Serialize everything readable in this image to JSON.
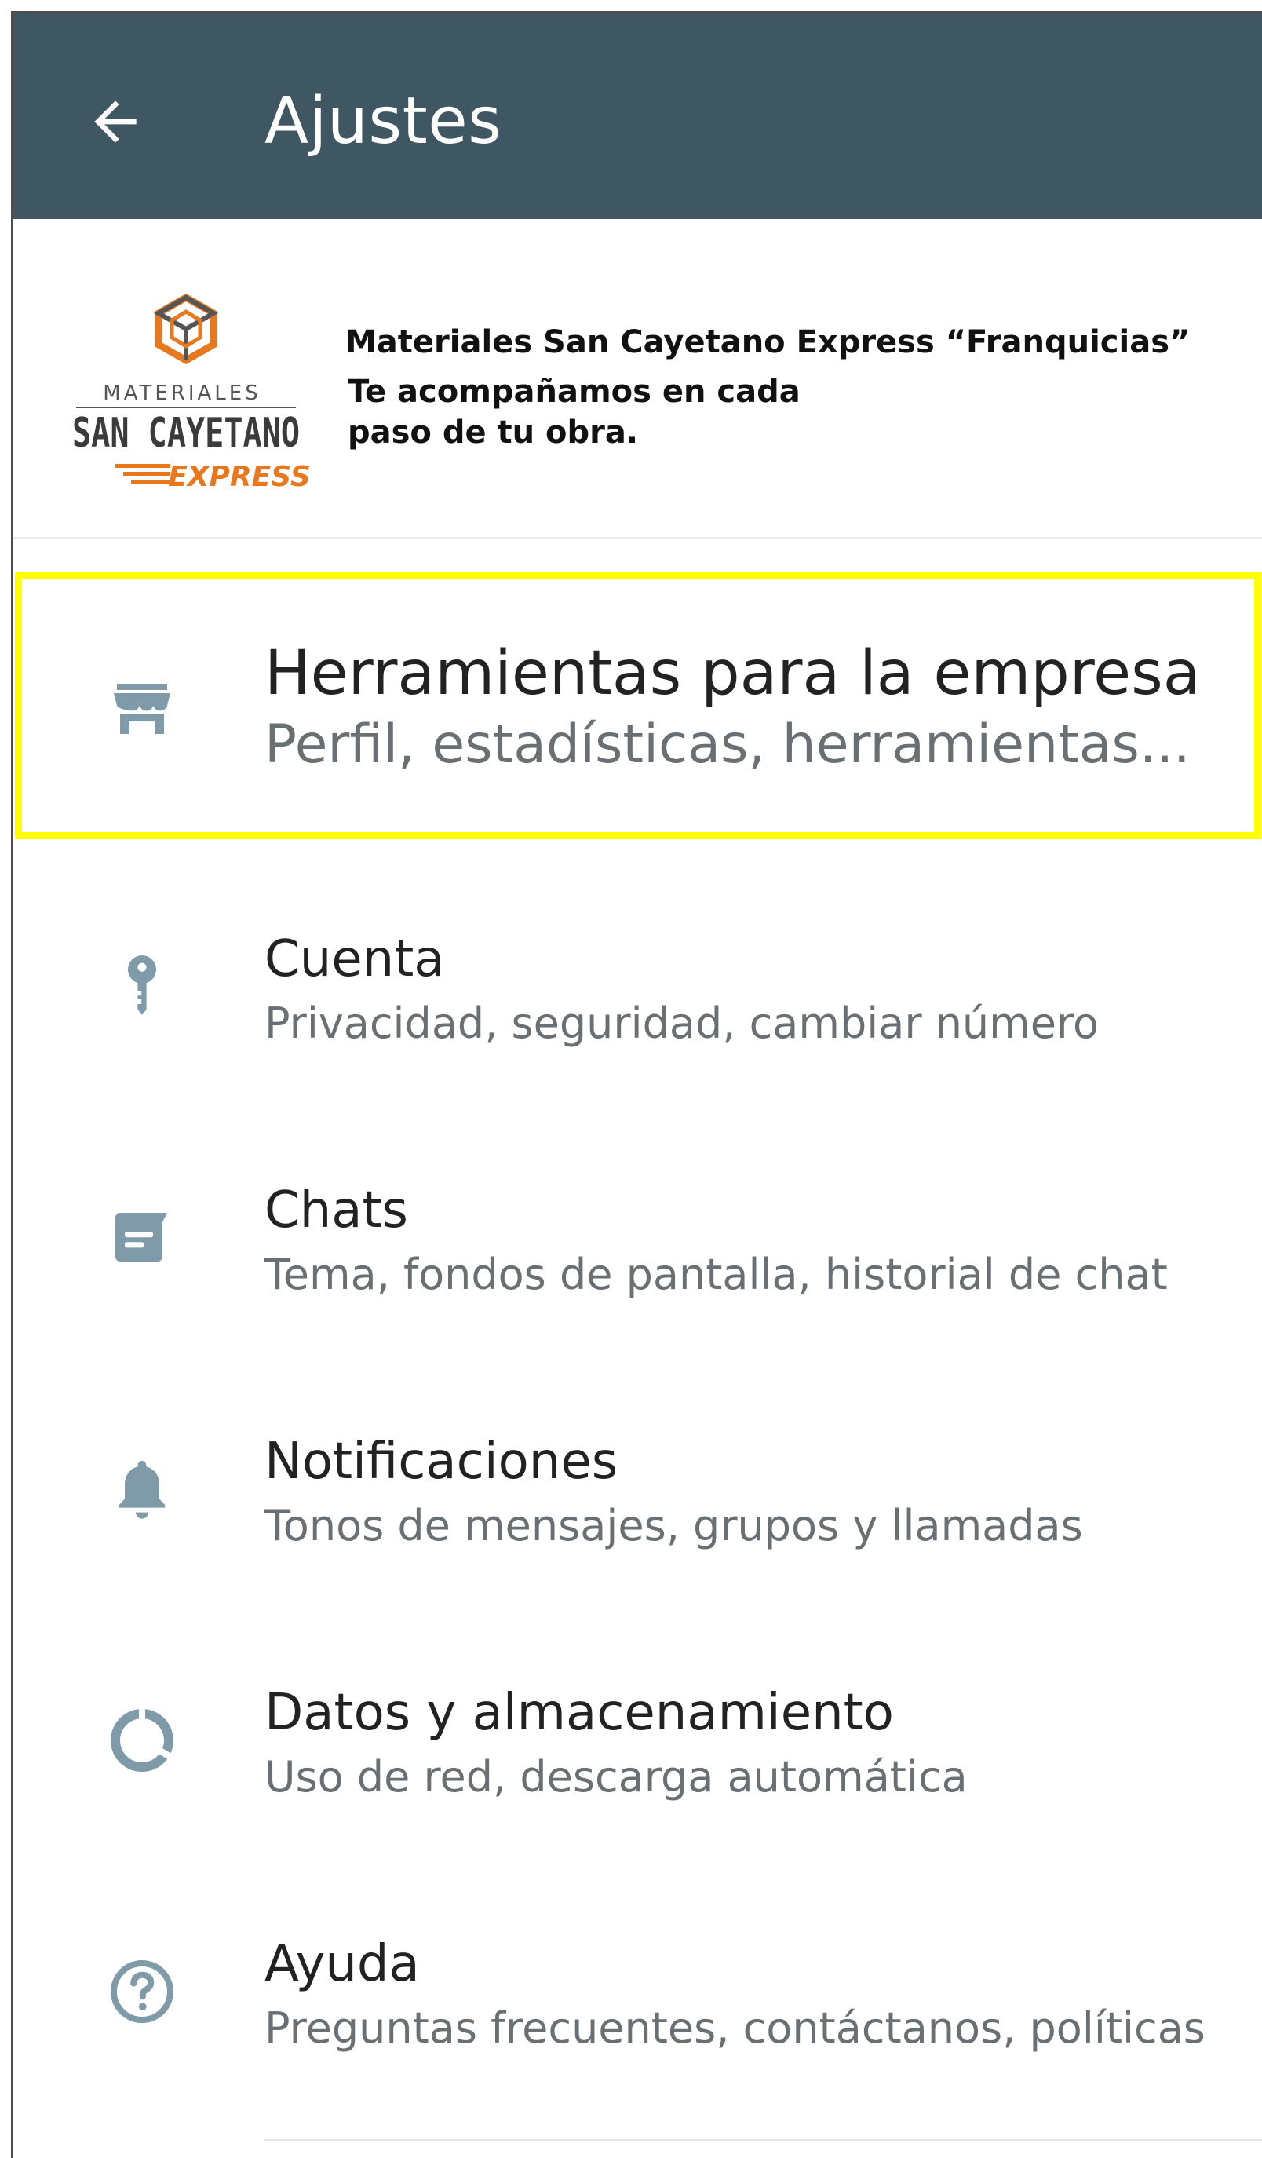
{
  "appbar": {
    "title": "Ajustes",
    "back_icon": "arrow-left-icon",
    "background": "#3f5663"
  },
  "profile": {
    "logo": {
      "top_text": "MATERIALES",
      "brand": "SAN CAYETANO",
      "sub": "EXPRESS",
      "accent": "#e8781e"
    },
    "name": "Materiales San Cayetano Express “Franquicias”",
    "tagline_line1": "Te acompañamos en cada",
    "tagline_line2": "paso de tu obra."
  },
  "highlight_color": "#ffff00",
  "icon_color": "#7f9aa8",
  "menu": [
    {
      "icon": "storefront-icon",
      "title": "Herramientas para la empresa",
      "subtitle": "Perfil, estadísticas, herramientas..."
    },
    {
      "icon": "key-icon",
      "title": "Cuenta",
      "subtitle": "Privacidad, seguridad, cambiar número"
    },
    {
      "icon": "chat-icon",
      "title": "Chats",
      "subtitle": "Tema, fondos de pantalla, historial de chat"
    },
    {
      "icon": "bell-icon",
      "title": "Notificaciones",
      "subtitle": "Tonos de mensajes, grupos y llamadas"
    },
    {
      "icon": "data-usage-icon",
      "title": "Datos y almacenamiento",
      "subtitle": "Uso de red, descarga automática"
    },
    {
      "icon": "help-icon",
      "title": "Ayuda",
      "subtitle": "Preguntas frecuentes, contáctanos, políticas"
    }
  ]
}
